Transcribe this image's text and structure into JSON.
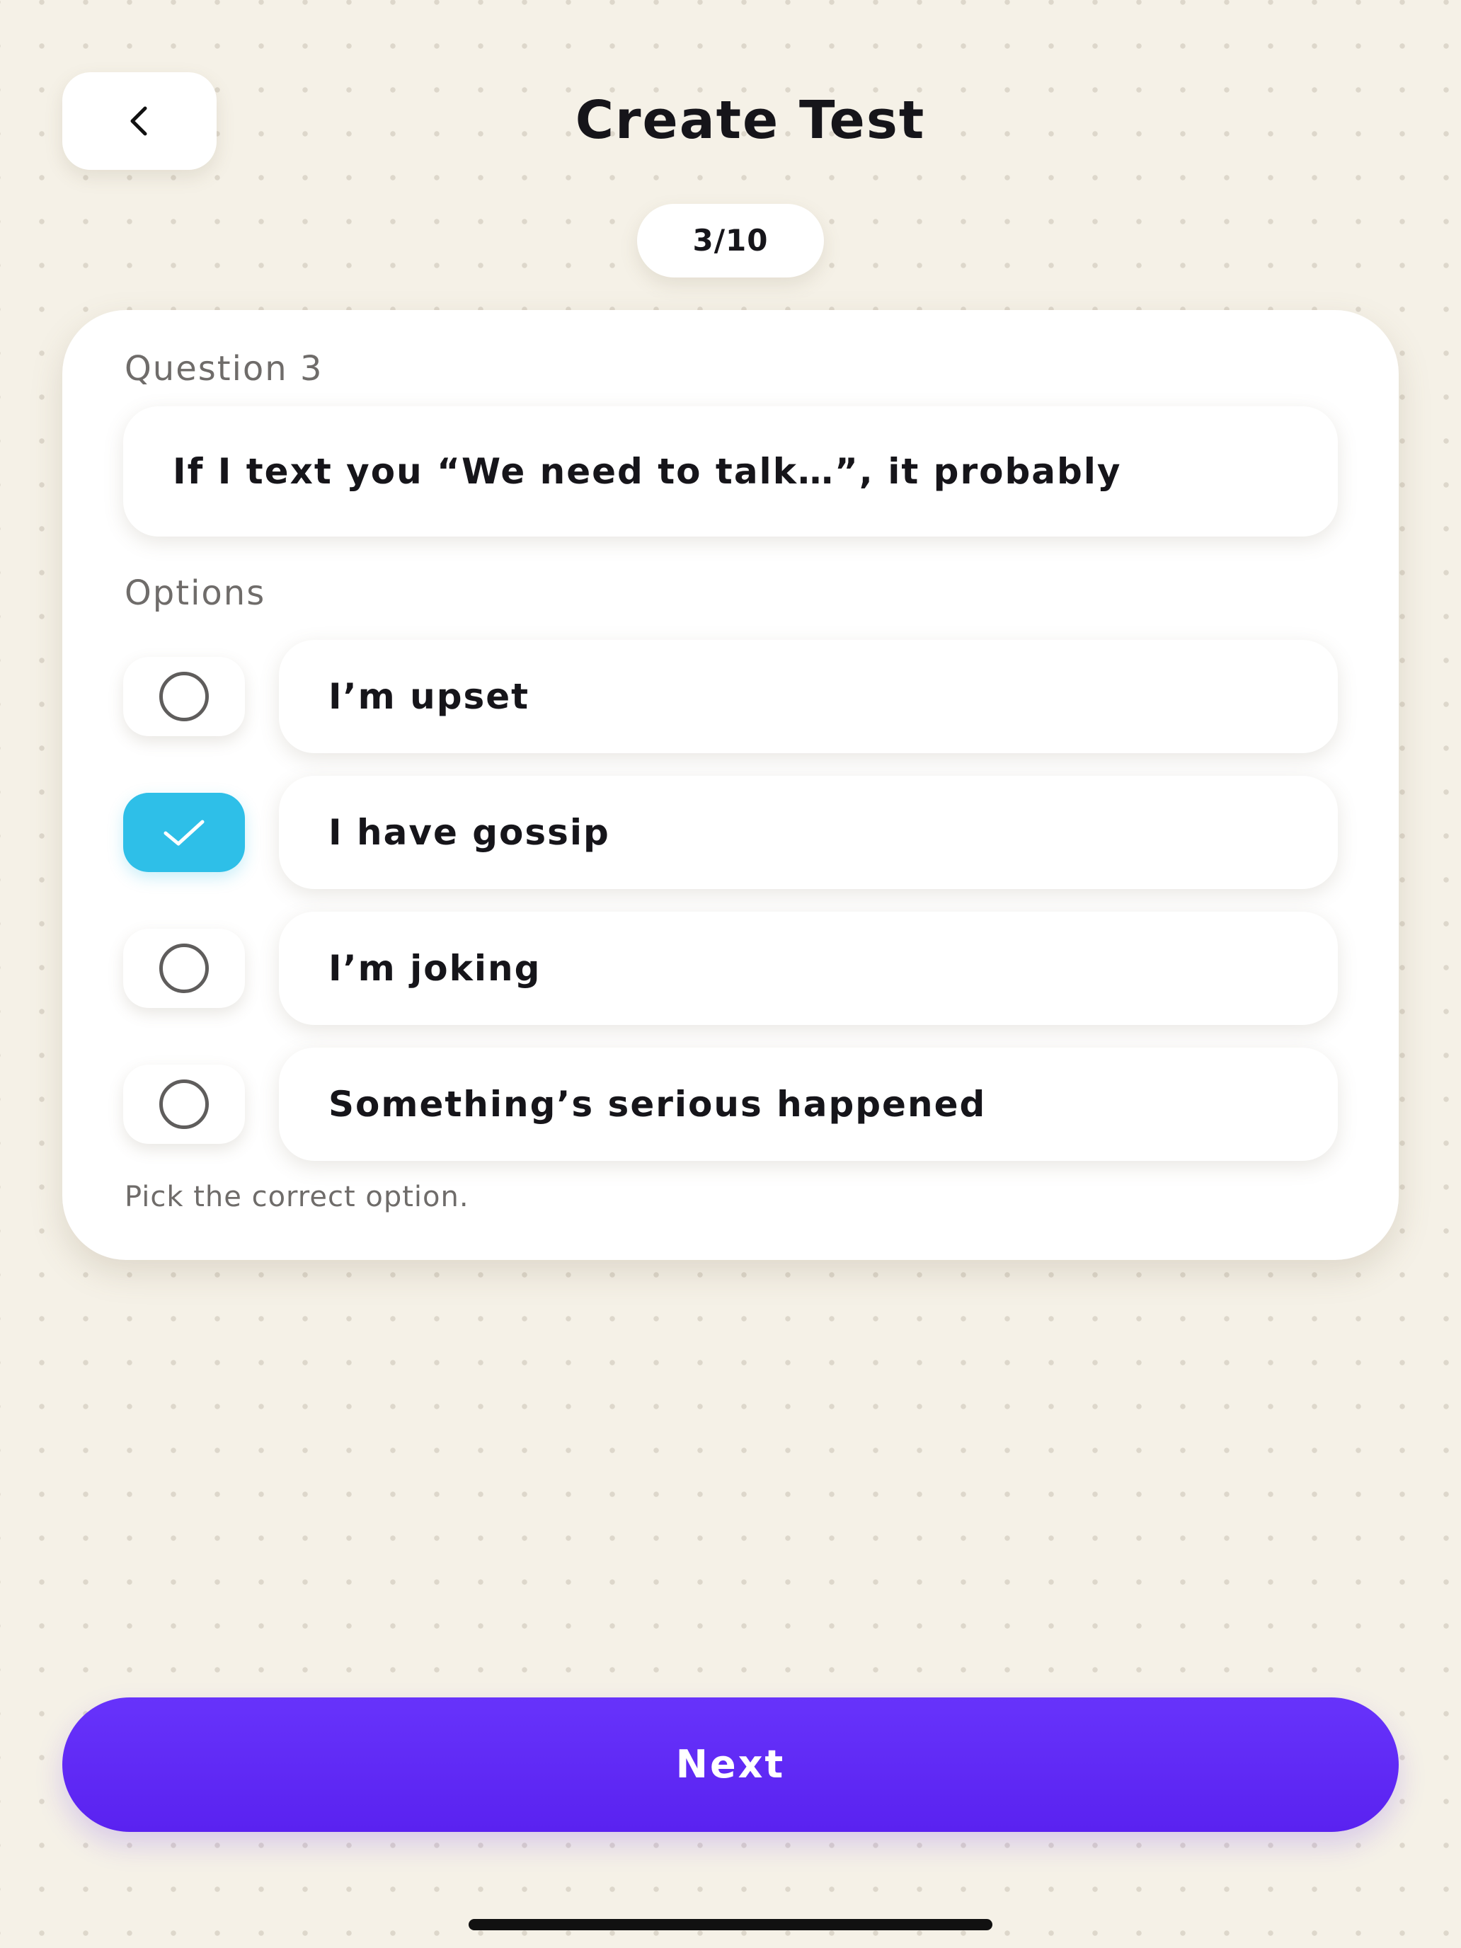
{
  "header": {
    "title": "Create Test",
    "back_icon": "chevron-left-icon",
    "progress": "3/10"
  },
  "question": {
    "label": "Question 3",
    "text": "If I text you “We need to talk…”, it probably"
  },
  "options": {
    "label": "Options",
    "items": [
      {
        "label": "I’m upset",
        "selected": false
      },
      {
        "label": "I have gossip",
        "selected": true
      },
      {
        "label": "I’m joking",
        "selected": false
      },
      {
        "label": "Something’s serious happened",
        "selected": false
      }
    ],
    "helper": "Pick the correct option."
  },
  "footer": {
    "next_label": "Next"
  },
  "colors": {
    "background": "#f5f1e7",
    "accent": "#5f27f5",
    "check": "#2ebfe8",
    "text": "#16151a",
    "muted": "#6f6c6a"
  }
}
